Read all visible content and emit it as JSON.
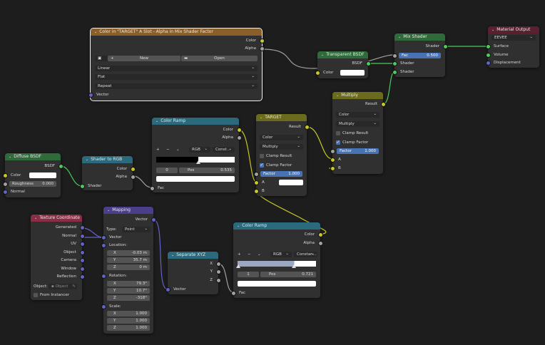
{
  "nodes": {
    "image_texture": {
      "title": "Color in \"TARGET\" A Slot - Alpha in Mix Shader Factor",
      "out_color": "Color",
      "out_alpha": "Alpha",
      "new_label": "New",
      "open_label": "Open",
      "interp": "Linear",
      "proj": "Flat",
      "ext": "Repeat",
      "in_vector": "Vector"
    },
    "transparent": {
      "title": "Transparent BSDF",
      "out": "BSDF",
      "in_color": "Color"
    },
    "mix_shader": {
      "title": "Mix Shader",
      "out": "Shader",
      "fac_label": "Fac",
      "fac_value": "0.500",
      "in1": "Shader",
      "in2": "Shader"
    },
    "material_output": {
      "title": "Material Output",
      "target": "EEVEE",
      "surface": "Surface",
      "volume": "Volume",
      "displacement": "Displacement"
    },
    "multiply": {
      "title": "Multiply",
      "out": "Result",
      "type": "Color",
      "blend": "Multiply",
      "clamp_result": "Clamp Result",
      "clamp_factor": "Clamp Factor",
      "factor_label": "Factor",
      "factor_value": "1.000",
      "a": "A",
      "b": "B"
    },
    "target": {
      "title": "TARGET",
      "out": "Result",
      "type": "Color",
      "blend": "Multiply",
      "clamp_result": "Clamp Result",
      "clamp_factor": "Clamp Factor",
      "factor_label": "Factor",
      "factor_value": "1.000",
      "a": "A",
      "b": "B"
    },
    "color_ramp1": {
      "title": "Color Ramp",
      "out_color": "Color",
      "out_alpha": "Alpha",
      "add": "+",
      "remove": "−",
      "chev": "⌄",
      "mode": "RGB",
      "interp": "Const...",
      "index": "0",
      "pos_label": "Pos",
      "pos_value": "0.535",
      "in_fac": "Fac"
    },
    "color_ramp2": {
      "title": "Color Ramp",
      "out_color": "Color",
      "out_alpha": "Alpha",
      "add": "+",
      "remove": "−",
      "chev": "⌄",
      "mode": "RGB",
      "interp": "Constan...",
      "index": "1",
      "pos_label": "Pos",
      "pos_value": "0.721",
      "in_fac": "Fac"
    },
    "diffuse": {
      "title": "Diffuse BSDF",
      "out": "BSDF",
      "color": "Color",
      "rough_label": "Roughness",
      "rough_value": "0.000",
      "normal": "Normal"
    },
    "shader_to_rgb": {
      "title": "Shader to RGB",
      "out_color": "Color",
      "out_alpha": "Alpha",
      "in": "Shader"
    },
    "texcoord": {
      "title": "Texture Coordinate",
      "outs": [
        "Generated",
        "Normal",
        "UV",
        "Object",
        "Camera",
        "Window",
        "Reflection"
      ],
      "object_label": "Object:",
      "object_placeholder": "Object",
      "from_instancer": "From Instancer"
    },
    "mapping": {
      "title": "Mapping",
      "out": "Vector",
      "type_label": "Type:",
      "type_value": "Point",
      "in_vector": "Vector",
      "location": "Location:",
      "loc": [
        "-0.03 m",
        "35.7 m",
        "0 m"
      ],
      "rotation": "Rotation:",
      "rot": [
        "79.3°",
        "10.7°",
        "-318°"
      ],
      "scale": "Scale:",
      "scl": [
        "1.000",
        "1.000",
        "1.000"
      ],
      "axes": [
        "X",
        "Y",
        "Z"
      ]
    },
    "separate_xyz": {
      "title": "Separate XYZ",
      "x": "X",
      "y": "Y",
      "z": "Z",
      "in": "Vector"
    }
  }
}
